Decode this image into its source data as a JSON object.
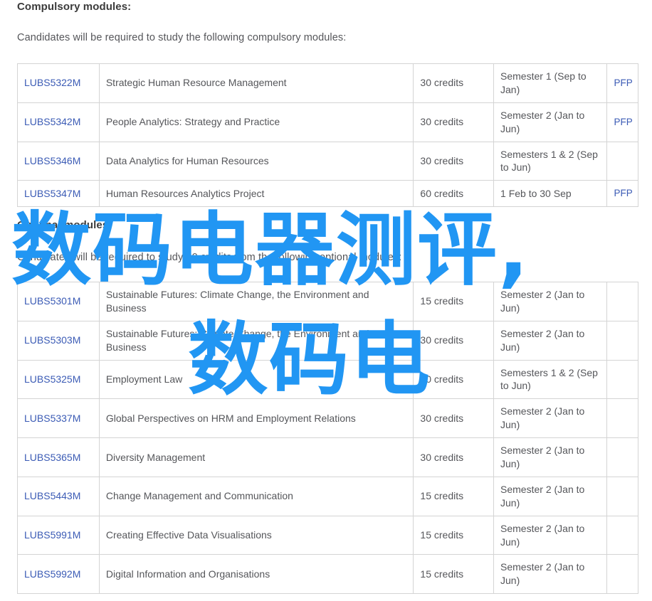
{
  "compulsory": {
    "heading": "Compulsory modules:",
    "intro": "Candidates will be required to study the following compulsory modules:",
    "rows": [
      {
        "code": "LUBS5322M",
        "title": "Strategic Human Resource Management",
        "credits": "30 credits",
        "semester": "Semester 1 (Sep to Jan)",
        "pfp": "PFP"
      },
      {
        "code": "LUBS5342M",
        "title": "People Analytics: Strategy and Practice",
        "credits": "30 credits",
        "semester": "Semester 2 (Jan to Jun)",
        "pfp": "PFP"
      },
      {
        "code": "LUBS5346M",
        "title": "Data Analytics for Human Resources",
        "credits": "30 credits",
        "semester": "Semesters 1 & 2 (Sep to Jun)",
        "pfp": ""
      },
      {
        "code": "LUBS5347M",
        "title": "Human Resources Analytics Project",
        "credits": "60 credits",
        "semester": "1 Feb to 30 Sep",
        "pfp": "PFP"
      }
    ]
  },
  "optional": {
    "heading": "Optional modules:",
    "intro": "Candidates will be required to study 30 credits from the following optional modules:",
    "rows": [
      {
        "code": "LUBS5301M",
        "title": "Sustainable Futures: Climate Change, the Environment and Business",
        "credits": "15 credits",
        "semester": "Semester 2 (Jan to Jun)",
        "pfp": ""
      },
      {
        "code": "LUBS5303M",
        "title": "Sustainable Futures: Climate Change, the Environment and Business",
        "credits": "30 credits",
        "semester": "Semester 2 (Jan to Jun)",
        "pfp": ""
      },
      {
        "code": "LUBS5325M",
        "title": "Employment Law",
        "credits": "30 credits",
        "semester": "Semesters 1 & 2 (Sep to Jun)",
        "pfp": ""
      },
      {
        "code": "LUBS5337M",
        "title": "Global Perspectives on HRM and Employment Relations",
        "credits": "30 credits",
        "semester": "Semester 2 (Jan to Jun)",
        "pfp": ""
      },
      {
        "code": "LUBS5365M",
        "title": "Diversity Management",
        "credits": "30 credits",
        "semester": "Semester 2 (Jan to Jun)",
        "pfp": ""
      },
      {
        "code": "LUBS5443M",
        "title": "Change Management and Communication",
        "credits": "15 credits",
        "semester": "Semester 2 (Jan to Jun)",
        "pfp": ""
      },
      {
        "code": "LUBS5991M",
        "title": "Creating Effective Data Visualisations",
        "credits": "15 credits",
        "semester": "Semester 2 (Jan to Jun)",
        "pfp": ""
      },
      {
        "code": "LUBS5992M",
        "title": "Digital Information and Organisations",
        "credits": "15 credits",
        "semester": "Semester 2 (Jan to Jun)",
        "pfp": ""
      }
    ]
  },
  "watermark": {
    "line1": "数码电器测评,",
    "line2": "数码电",
    "color": "#2196f3"
  },
  "colors": {
    "link": "#3b5bb5",
    "text": "#55565a",
    "heading": "#3b3b3b",
    "border": "#d4d4d4"
  }
}
